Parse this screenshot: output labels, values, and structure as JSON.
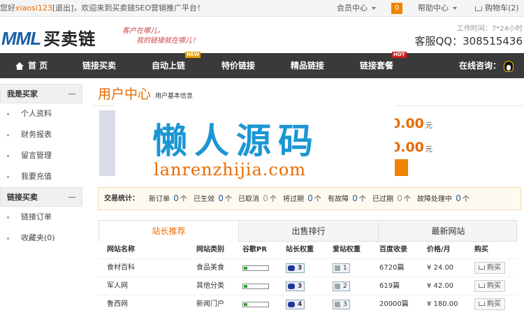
{
  "topbar": {
    "greet_prefix": "您好",
    "username": "xiaosi123",
    "logout": "[退出]",
    "welcome": "，欢迎来到买卖链SEO营销推广平台！",
    "member_center": "会员中心",
    "cart_count": "0",
    "help_center": "帮助中心",
    "cart": "购物车(2)"
  },
  "header": {
    "logo_en": "MML",
    "logo_cn": "买卖链",
    "slogan_1": "客户在哪儿，",
    "slogan_2": "我的链接就在哪儿！",
    "hours": "工作时间：7*24小时",
    "qq": "客服QQ：308515436"
  },
  "nav": {
    "items": [
      {
        "label": "首 页"
      },
      {
        "label": "链接买卖"
      },
      {
        "label": "自动上链",
        "badge": "NEW"
      },
      {
        "label": "特价链接"
      },
      {
        "label": "精品链接"
      },
      {
        "label": "链接套餐",
        "badge": "HOT"
      }
    ],
    "consult": "在线咨询："
  },
  "sidebar": {
    "groups": [
      {
        "title": "我是买家",
        "items": [
          "个人资料",
          "财务报表",
          "留言管理",
          "我要充值"
        ]
      },
      {
        "title": "链接买卖",
        "items": [
          "链接订单",
          "收藏夹(0)"
        ]
      }
    ]
  },
  "main": {
    "title": "用户中心",
    "subtitle": "用户基本信息",
    "balance_1": "0.00",
    "balance_2": "0.00",
    "currency": "元"
  },
  "watermark": {
    "cn": "懒人源码",
    "en": "lanrenzhijia.com"
  },
  "stats": {
    "label": "交易统计：",
    "items": [
      {
        "label": "新订单",
        "count": "0",
        "unit": "个"
      },
      {
        "label": "已生效",
        "count": "0",
        "unit": "个"
      },
      {
        "label": "已取消",
        "count": "0",
        "unit": "个"
      },
      {
        "label": "将过期",
        "count": "0",
        "unit": "个"
      },
      {
        "label": "有故障",
        "count": "0",
        "unit": "个"
      },
      {
        "label": "已过期",
        "count": "0",
        "unit": "个"
      },
      {
        "label": "故障处理中",
        "count": "0",
        "unit": "个"
      }
    ]
  },
  "tabs": [
    "站长推荐",
    "出售排行",
    "最新网站"
  ],
  "table": {
    "headers": [
      "网站名称",
      "网站类别",
      "谷歌PR",
      "站长权重",
      "爱站权重",
      "百度收录",
      "价格/月",
      "购买"
    ],
    "rows": [
      {
        "name": "食材百科",
        "category": "食品美食",
        "pr": 0,
        "baidu_weight": "3",
        "aizhan_weight": "1",
        "indexed": "6720篇",
        "price": "¥ 24.00",
        "buy": "购买"
      },
      {
        "name": "军人网",
        "category": "其他分类",
        "pr": 0,
        "baidu_weight": "3",
        "aizhan_weight": "2",
        "indexed": "619篇",
        "price": "¥ 42.00",
        "buy": "购买"
      },
      {
        "name": "鲁西网",
        "category": "新闻门户",
        "pr": 0,
        "baidu_weight": "4",
        "aizhan_weight": "3",
        "indexed": "20000篇",
        "price": "¥ 180.00",
        "buy": "购买"
      }
    ]
  }
}
